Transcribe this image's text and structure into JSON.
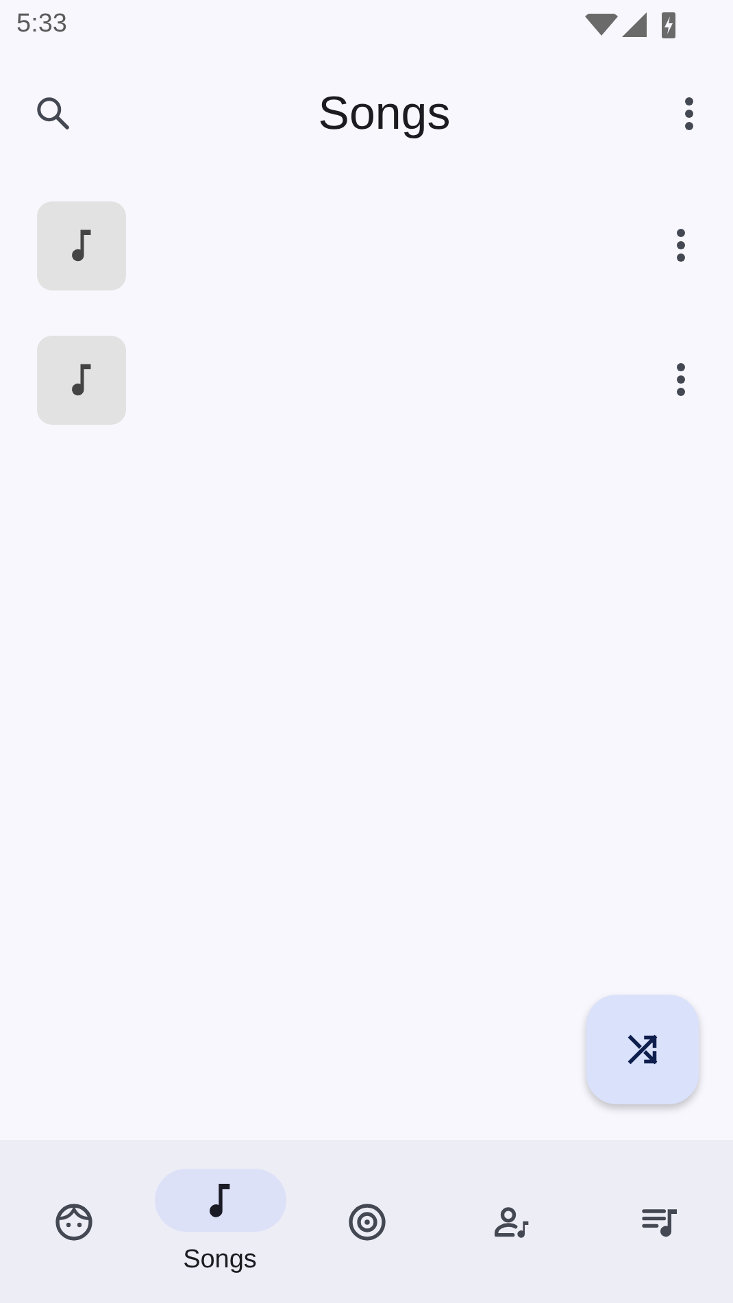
{
  "status_bar": {
    "time": "5:33"
  },
  "app_bar": {
    "title": "Songs"
  },
  "songs": [
    {
      "kind": "song"
    },
    {
      "kind": "song"
    }
  ],
  "shuffle_button": {
    "kind": "shuffle"
  },
  "nav": [
    {
      "kind": "for-you",
      "selected": false
    },
    {
      "kind": "songs",
      "selected": true,
      "label": "Songs"
    },
    {
      "kind": "albums",
      "selected": false
    },
    {
      "kind": "artists",
      "selected": false
    },
    {
      "kind": "playlists",
      "selected": false
    }
  ]
}
